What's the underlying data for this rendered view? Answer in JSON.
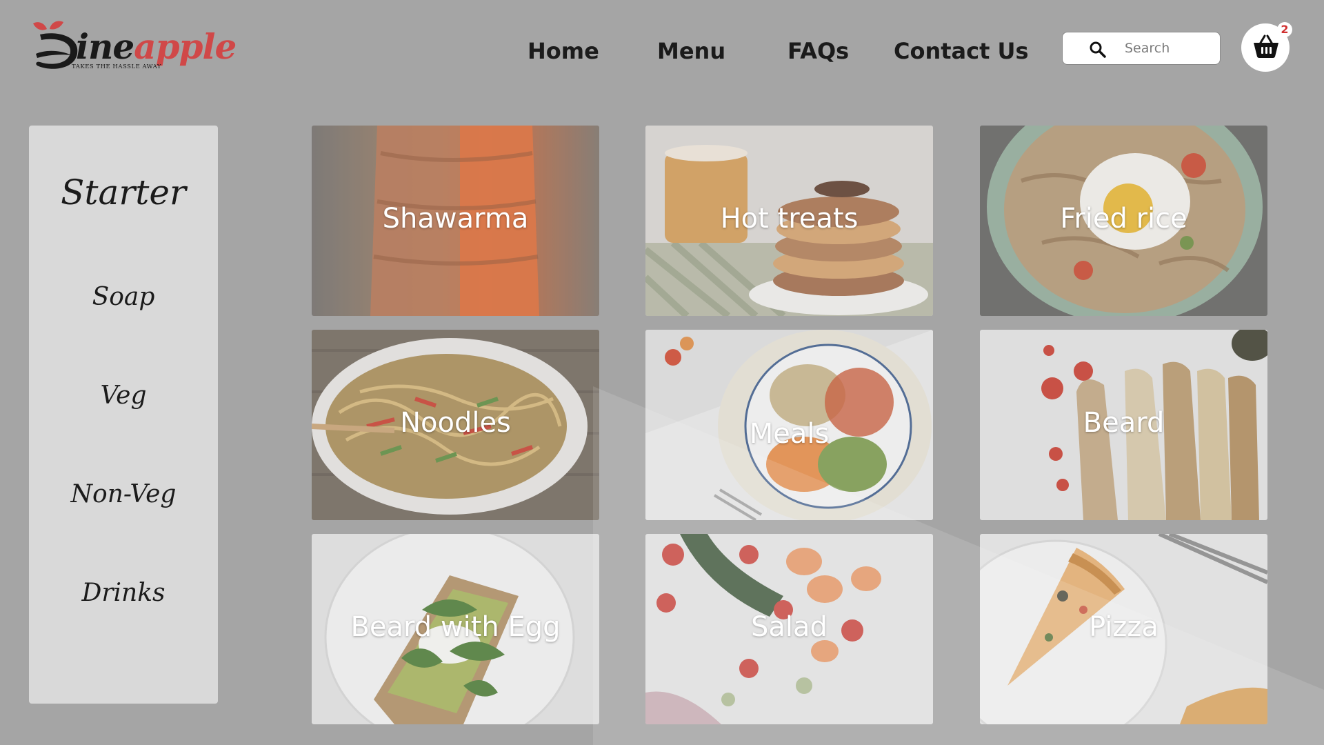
{
  "brand": {
    "name_part1": "ineapple",
    "name_part2": "",
    "name_dark": "ine",
    "name_red": "apple",
    "tagline": "TAKES THE HASSLE AWAY",
    "accent": "#d04848",
    "icon": "d-leaf-logo-icon"
  },
  "nav": {
    "items": [
      {
        "label": "Home"
      },
      {
        "label": "Menu"
      },
      {
        "label": "FAQs"
      },
      {
        "label": "Contact Us"
      }
    ]
  },
  "search": {
    "placeholder": "Search",
    "icon": "search-icon"
  },
  "cart": {
    "icon": "basket-icon",
    "count": "2"
  },
  "sidebar": {
    "title": "Starter",
    "items": [
      {
        "label": "Soap"
      },
      {
        "label": "Veg"
      },
      {
        "label": "Non-Veg"
      },
      {
        "label": "Drinks"
      }
    ]
  },
  "dishes": [
    {
      "label": "Shawarma"
    },
    {
      "label": "Hot treats"
    },
    {
      "label": "Fried rice"
    },
    {
      "label": "Noodles"
    },
    {
      "label": "Meals"
    },
    {
      "label": "Beard"
    },
    {
      "label": "Beard with Egg"
    },
    {
      "label": "Salad"
    },
    {
      "label": "Pizza"
    }
  ]
}
